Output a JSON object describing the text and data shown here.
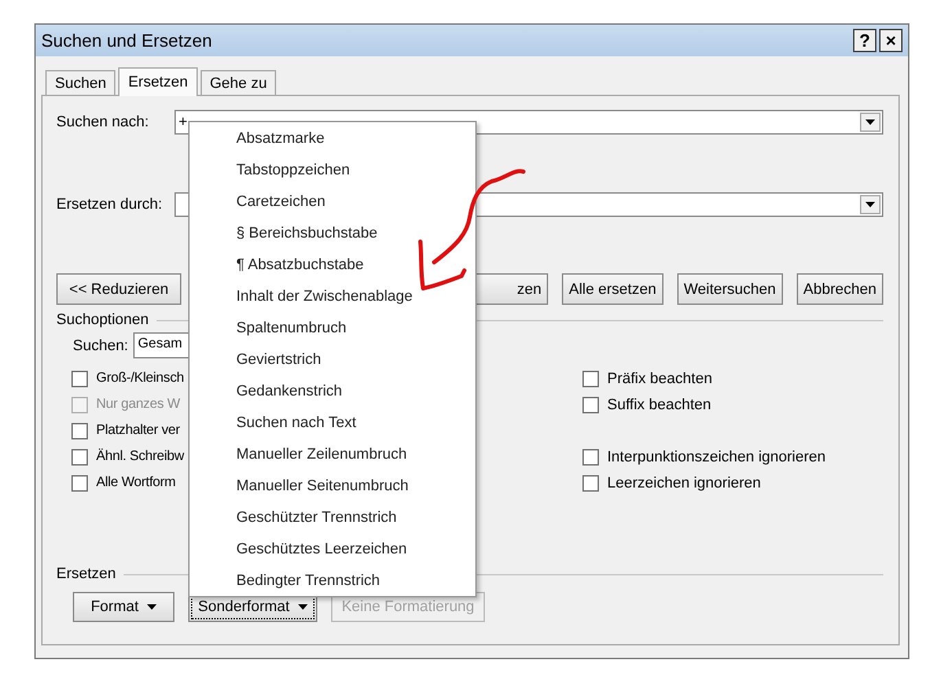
{
  "window": {
    "title": "Suchen und Ersetzen",
    "help": "?",
    "close": "×"
  },
  "tabs": [
    {
      "label": "Suchen",
      "selected": false
    },
    {
      "label": "Ersetzen",
      "selected": true
    },
    {
      "label": "Gehe zu",
      "selected": false
    }
  ],
  "find": {
    "label": "Suchen nach:",
    "value": "+"
  },
  "replace": {
    "label": "Ersetzen durch:"
  },
  "buttons": [
    {
      "label": "<< Reduzieren"
    },
    {
      "label": "zen"
    },
    {
      "label": "Alle ersetzen"
    },
    {
      "label": "Weitersuchen"
    },
    {
      "label": "Abbrechen"
    }
  ],
  "search_options": {
    "title": "Suchoptionen",
    "scope_label": "Suchen:",
    "scope_value": "Gesam",
    "left": [
      {
        "label": "Groß-/Kleinsch",
        "checked": false,
        "disabled": false
      },
      {
        "label": "Nur ganzes W",
        "checked": false,
        "disabled": true
      },
      {
        "label": "Platzhalter ver",
        "checked": false,
        "disabled": false
      },
      {
        "label": "Ähnl. Schreibw",
        "checked": false,
        "disabled": false
      },
      {
        "label": "Alle Wortform",
        "checked": false,
        "disabled": false
      }
    ],
    "right_groups": [
      [
        {
          "label": "Präfix beachten",
          "checked": false,
          "disabled": false
        },
        {
          "label": "Suffix beachten",
          "checked": false,
          "disabled": false
        }
      ],
      [
        {
          "label": "Interpunktionszeichen ignorieren",
          "checked": false,
          "disabled": false
        },
        {
          "label": "Leerzeichen ignorieren",
          "checked": false,
          "disabled": false
        }
      ]
    ]
  },
  "replace_section": {
    "title": "Ersetzen",
    "buttons": [
      {
        "label": "Format",
        "dropdown": true,
        "focused": false,
        "disabled": false
      },
      {
        "label": "Sonderformat",
        "dropdown": true,
        "focused": true,
        "disabled": false
      },
      {
        "label": "Keine Formatierung",
        "dropdown": false,
        "focused": false,
        "disabled": true
      }
    ]
  },
  "menu": {
    "items": [
      "Absatzmarke",
      "Tabstoppzeichen",
      "Caretzeichen",
      "§ Bereichsbuchstabe",
      "¶ Absatzbuchstabe",
      "Inhalt der Zwischenablage",
      "Spaltenumbruch",
      "Geviertstrich",
      "Gedankenstrich",
      "Suchen nach Text",
      "Manueller Zeilenumbruch",
      "Manueller Seitenumbruch",
      "Geschützter Trennstrich",
      "Geschütztes Leerzeichen",
      "Bedingter Trennstrich"
    ]
  }
}
